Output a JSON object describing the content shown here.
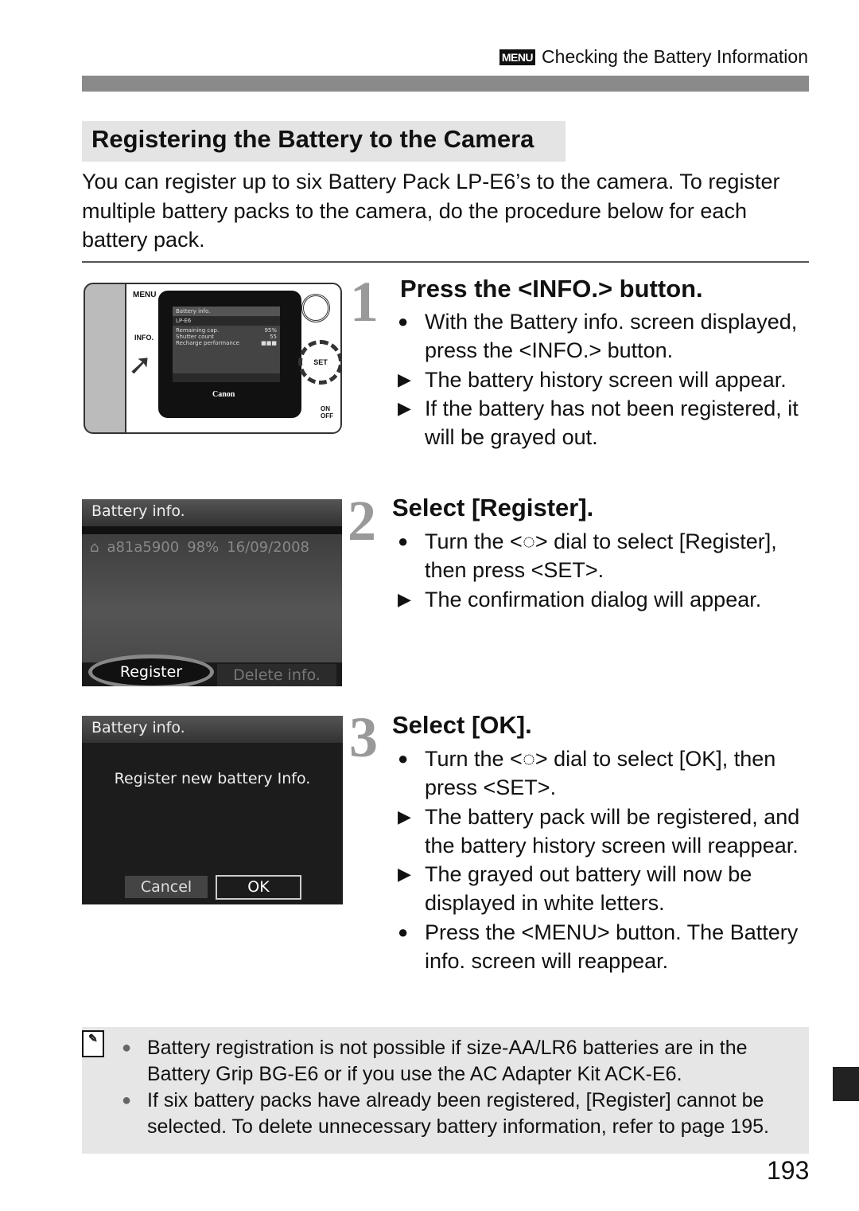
{
  "header": {
    "menu_icon": "MENU",
    "title": "Checking the Battery Information"
  },
  "section_title": "Registering the Battery to the Camera",
  "intro": "You can register up to six Battery Pack LP-E6’s to the camera. To register multiple battery packs to the camera, do the procedure below for each battery pack.",
  "steps": [
    {
      "number": "1",
      "title": "Press the <INFO.> button.",
      "items": [
        {
          "marker": "●",
          "text": "With the Battery info. screen displayed, press the <INFO.> button."
        },
        {
          "marker": "▶",
          "text": "The battery history screen will appear."
        },
        {
          "marker": "▶",
          "text": "If the battery has not been registered, it will be grayed out."
        }
      ]
    },
    {
      "number": "2",
      "title": "Select [Register].",
      "items": [
        {
          "marker": "●",
          "text": "Turn the <◌> dial to select [Register], then press <SET>."
        },
        {
          "marker": "▶",
          "text": "The confirmation dialog will appear."
        }
      ]
    },
    {
      "number": "3",
      "title": "Select [OK].",
      "items": [
        {
          "marker": "●",
          "text": "Turn the <◌> dial to select [OK], then press <SET>."
        },
        {
          "marker": "▶",
          "text": "The battery pack will be registered, and the battery history screen will reappear."
        },
        {
          "marker": "▶",
          "text": "The grayed out battery will now be displayed in white letters."
        },
        {
          "marker": "●",
          "text": "Press the <MENU> button. The Battery info. screen will reappear."
        }
      ]
    }
  ],
  "camera_screen": {
    "title": "Battery info.",
    "battery": "LP-E6",
    "rows": [
      [
        "Remaining cap.",
        "95%"
      ],
      [
        "Shutter count",
        "55"
      ],
      [
        "Recharge performance",
        "■■■"
      ]
    ],
    "brand": "Canon",
    "buttons": [
      "MENU",
      "INFO.",
      "SET",
      "ON",
      "OFF"
    ]
  },
  "screen2": {
    "title": "Battery info.",
    "battery_id": "a81a5900",
    "percent": "98%",
    "date": "16/09/2008",
    "register": "Register",
    "delete": "Delete info."
  },
  "screen3": {
    "title": "Battery info.",
    "message": "Register new battery Info.",
    "cancel": "Cancel",
    "ok": "OK"
  },
  "note": {
    "icon": "memo-icon",
    "items": [
      "Battery registration is not possible if size-AA/LR6 batteries are in the Battery Grip BG-E6 or if you use the AC Adapter Kit ACK-E6.",
      "If six battery packs have already been registered, [Register] cannot be selected. To delete unnecessary battery information, refer to page 195."
    ]
  },
  "page_number": "193"
}
